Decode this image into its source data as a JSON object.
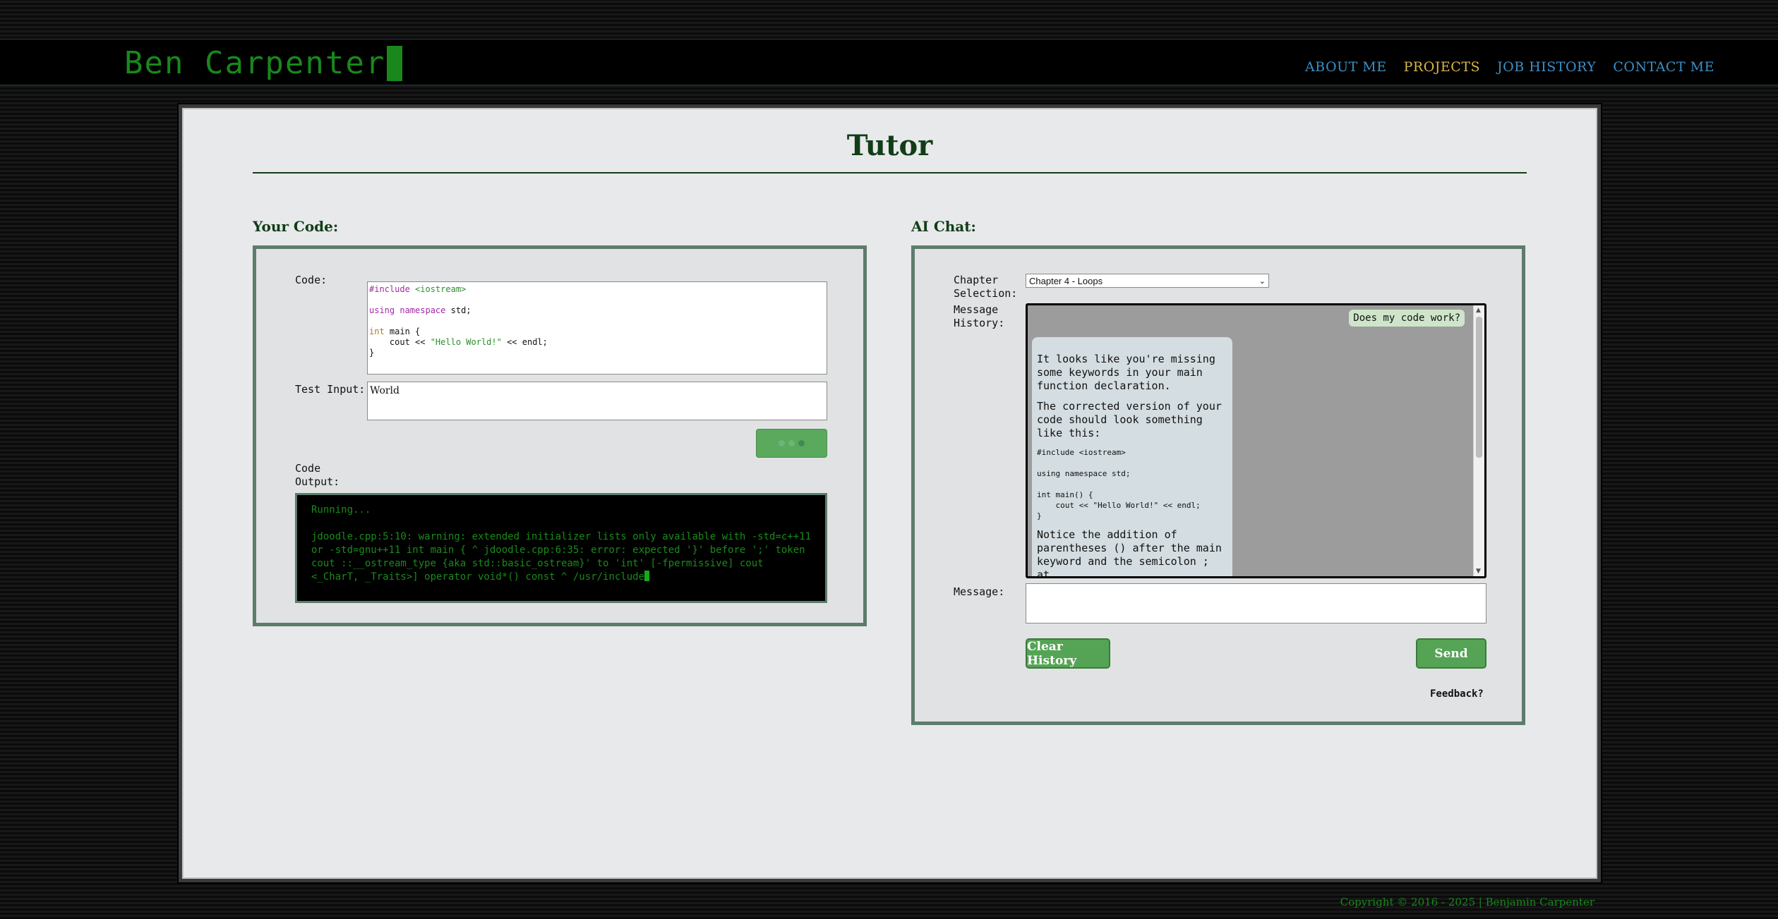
{
  "brand": {
    "name": "Ben Carpenter"
  },
  "nav": {
    "items": [
      {
        "label": "ABOUT ME"
      },
      {
        "label": "PROJECTS"
      },
      {
        "label": "JOB HISTORY"
      },
      {
        "label": "CONTACT ME"
      }
    ],
    "active": "PROJECTS"
  },
  "page": {
    "title": "Tutor"
  },
  "code_section": {
    "heading": "Your Code:",
    "code_label": "Code:",
    "code_lines": [
      "#include <iostream>",
      "",
      "using namespace std;",
      "",
      "int main {",
      "    cout << \"Hello World!\" << endl;",
      "}"
    ],
    "test_input_label": "Test Input:",
    "test_input_value": "World",
    "output_label": "Code Output:",
    "output_status": "Running...",
    "output_text": "jdoodle.cpp:5:10: warning: extended initializer lists only available with -std=c++11 or -std=gnu++11 int main { ^ jdoodle.cpp:6:35: error: expected '}' before ';' token cout ::__ostream_type {aka std::basic_ostream}' to 'int' [-fpermissive] cout <_CharT, _Traits>] operator void*() const ^ /usr/include"
  },
  "chat_section": {
    "heading": "AI Chat:",
    "chapter_label": "Chapter Selection:",
    "chapter_value": "Chapter 4 - Loops",
    "history_label": "Message History:",
    "user_message": "Does my code work?",
    "ai_message": {
      "p1": "It looks like you're missing some keywords in your main function declaration.",
      "p2": "The corrected version of your code should look something like this:",
      "code": "#include <iostream>\n\nusing namespace std;\n\nint main() {\n    cout << \"Hello World!\" << endl;\n}",
      "p3": "Notice the addition of parentheses () after the main keyword and the semicolon ; at"
    },
    "message_label": "Message:",
    "message_value": "",
    "clear_label": "Clear History",
    "send_label": "Send",
    "feedback_label": "Feedback?"
  },
  "footer": {
    "copyright": "Copyright © 2016 - 2025 | Benjamin Carpenter"
  }
}
